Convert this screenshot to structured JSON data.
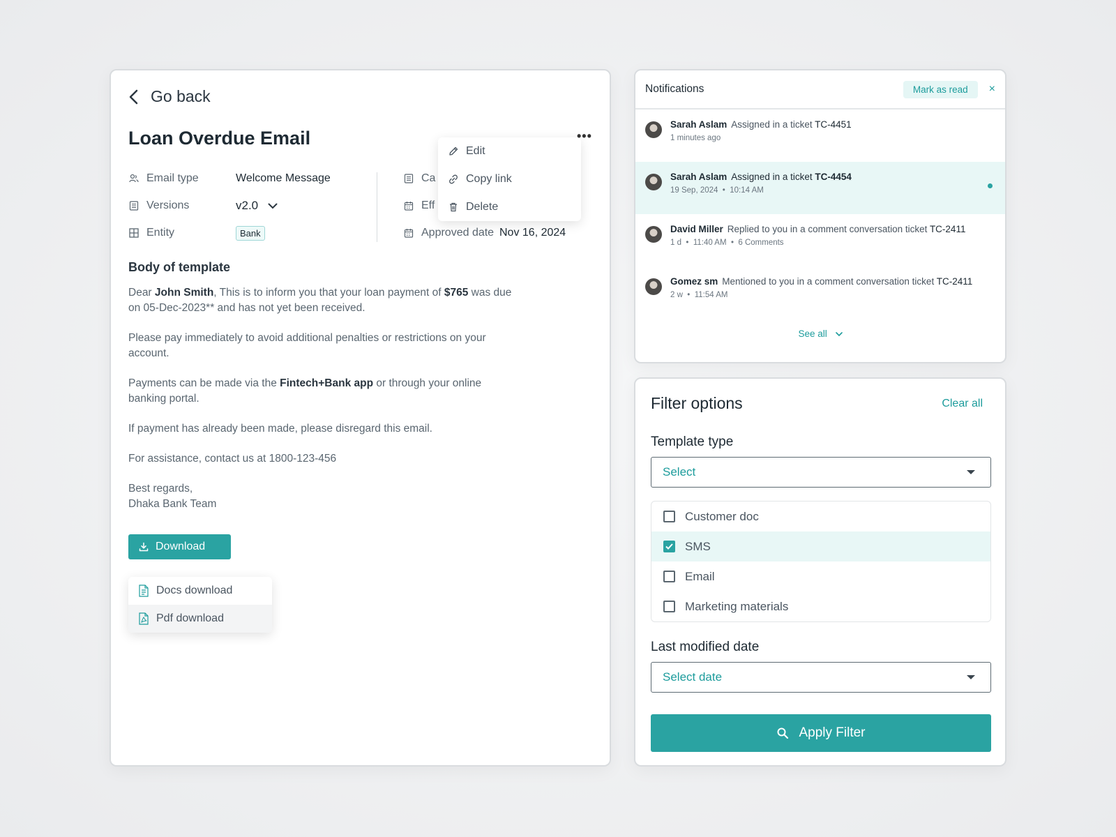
{
  "detail": {
    "back_label": "Go back",
    "title": "Loan Overdue Email",
    "menu": {
      "edit": "Edit",
      "copy_link": "Copy link",
      "delete": "Delete"
    },
    "meta": {
      "email_type_label": "Email type",
      "email_type_value": "Welcome Message",
      "versions_label": "Versions",
      "versions_value": "v2.0",
      "entity_label": "Entity",
      "entity_value": "Bank",
      "category_label": "Ca",
      "effective_label": "Eff",
      "approved_label": "Approved date",
      "approved_value": "Nov 16, 2024"
    },
    "body_title": "Body of template",
    "body": {
      "p1_a": "Dear ",
      "p1_name": "John Smith",
      "p1_b": ", This is to inform you that your loan payment of ",
      "p1_amount": "$765",
      "p1_c": " was due on 05-Dec-2023** and has not yet been received.",
      "p2": "Please pay immediately to avoid additional penalties or restrictions on your account.",
      "p3_a": "Payments can be made via the ",
      "p3_app": "Fintech+Bank app",
      "p3_b": " or through your online banking portal.",
      "p4": "If payment has already been made, please disregard this email.",
      "p5": "For assistance, contact us at 1800-123-456",
      "p6_line1": "Best regards,",
      "p6_line2": "Dhaka Bank Team"
    },
    "download_label": "Download",
    "download_options": {
      "docs": "Docs download",
      "pdf": "Pdf download"
    }
  },
  "notifications": {
    "title": "Notifications",
    "mark_read": "Mark as read",
    "close": "×",
    "items": [
      {
        "name": "Sarah Aslam",
        "action": "Assigned in a ticket ",
        "ticket": "TC-4451",
        "time": "1 minutes ago",
        "date": "",
        "comments": ""
      },
      {
        "name": "Sarah Aslam",
        "action": "Assigned in a ticket ",
        "ticket": "TC-4454",
        "time": "10:14 AM",
        "date": "19 Sep, 2024",
        "comments": ""
      },
      {
        "name": "David Miller",
        "action": "Replied to you in a comment conversation ticket ",
        "ticket": "TC-2411",
        "time": "11:40 AM",
        "date": "1 d",
        "comments": "6 Comments"
      },
      {
        "name": "Gomez sm",
        "action": "Mentioned to you in a comment conversation ticket ",
        "ticket": "TC-2411",
        "time": "11:54 AM",
        "date": "2 w",
        "comments": ""
      }
    ],
    "see_all": "See all"
  },
  "filter": {
    "title": "Filter options",
    "clear_all": "Clear all",
    "template_type_label": "Template type",
    "template_type_placeholder": "Select",
    "options": [
      {
        "label": "Customer doc",
        "checked": false
      },
      {
        "label": "SMS",
        "checked": true
      },
      {
        "label": "Email",
        "checked": false
      },
      {
        "label": "Marketing materials",
        "checked": false
      }
    ],
    "last_modified_label": "Last modified date",
    "date_placeholder": "Select date",
    "apply_label": "Apply Filter"
  },
  "colors": {
    "accent": "#2aa3a2",
    "accent_light": "#e8f7f6",
    "text": "#1e2a33"
  }
}
